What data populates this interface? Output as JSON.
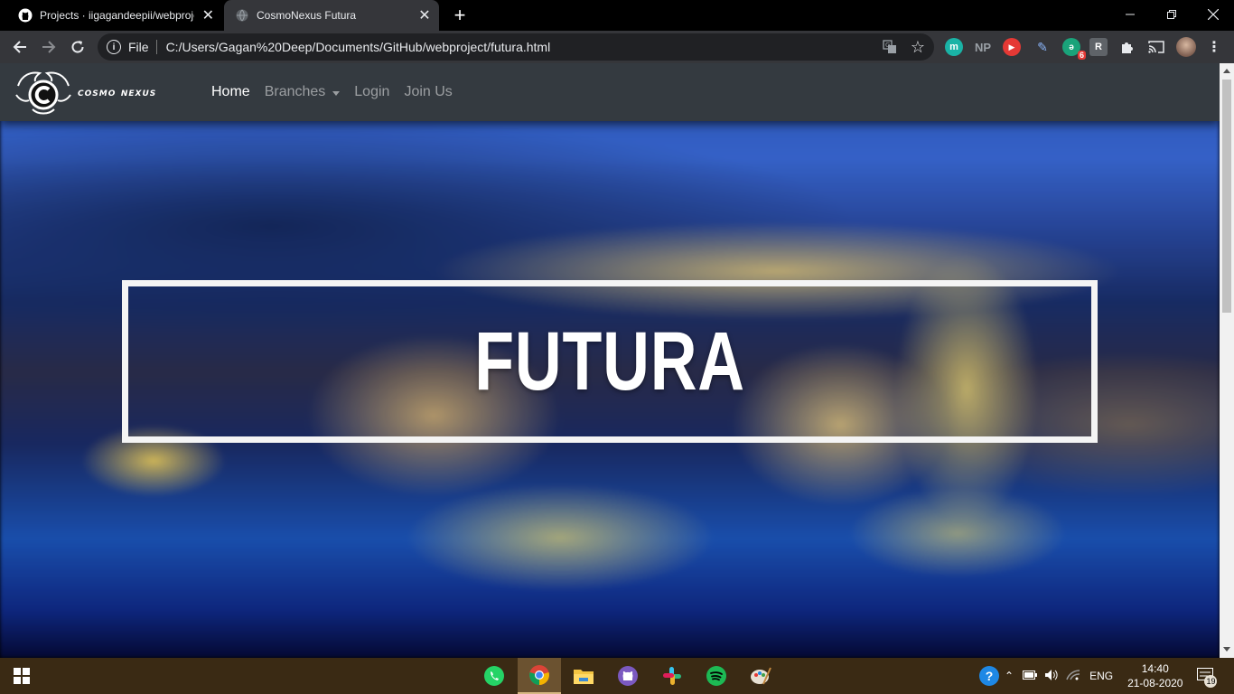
{
  "browser": {
    "tabs": [
      {
        "title": "Projects · iigagandeepii/webproje",
        "active": false,
        "icon": "github-icon"
      },
      {
        "title": "CosmoNexus Futura",
        "active": true,
        "icon": "globe-icon"
      }
    ],
    "new_tab_label": "+",
    "address": {
      "scheme_label": "File",
      "url": "C:/Users/Gagan%20Deep/Documents/GitHub/webproject/futura.html"
    },
    "extensions": [
      {
        "name": "m-extension-icon",
        "label": "m",
        "color": "#1ab3a6"
      },
      {
        "name": "np-extension-icon",
        "label": "NP",
        "color": "#9aa0a6"
      },
      {
        "name": "youtube-extension-icon",
        "label": "▶",
        "color": "#e53935"
      },
      {
        "name": "pen-extension-icon",
        "label": "✎",
        "color": "#8ab4f8"
      },
      {
        "name": "badge-extension-icon",
        "label": "6",
        "color": "#1aa37a"
      },
      {
        "name": "r-extension-icon",
        "label": "R",
        "color": "#9aa0a6"
      }
    ]
  },
  "page": {
    "brand": "cosmo nexus",
    "nav": {
      "home": "Home",
      "branches": "Branches",
      "login": "Login",
      "join": "Join Us"
    },
    "hero_title": "FUTURA"
  },
  "taskbar": {
    "apps": [
      "whatsapp-icon",
      "chrome-icon",
      "file-explorer-icon",
      "github-desktop-icon",
      "slack-icon",
      "spotify-icon",
      "paint-icon"
    ],
    "language": "ENG",
    "time": "14:40",
    "date": "21-08-2020",
    "notification_count": "19"
  }
}
